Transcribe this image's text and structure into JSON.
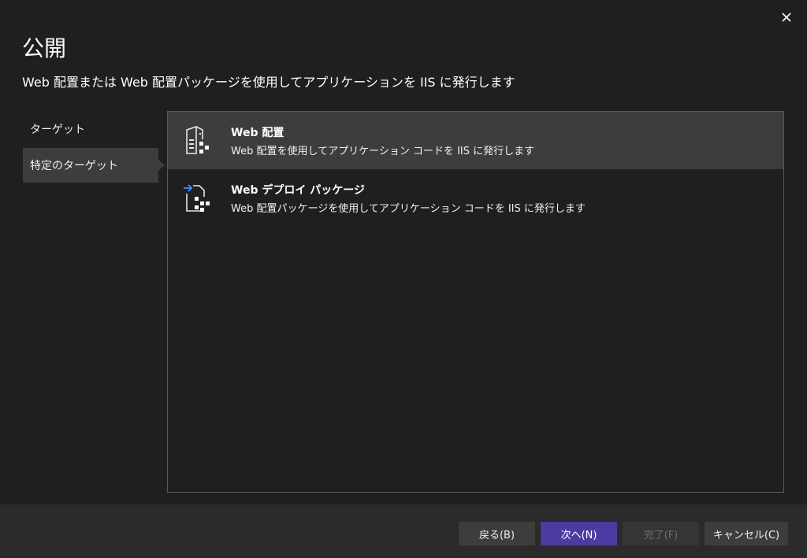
{
  "dialog": {
    "title": "公開",
    "subtitle": "Web 配置または Web 配置パッケージを使用してアプリケーションを IIS に発行します"
  },
  "nav": {
    "items": [
      {
        "label": "ターゲット",
        "selected": false
      },
      {
        "label": "特定のターゲット",
        "selected": true
      }
    ]
  },
  "options": [
    {
      "title": "Web 配置",
      "description": "Web 配置を使用してアプリケーション コードを IIS に発行します",
      "icon": "web-deploy-icon",
      "selected": true
    },
    {
      "title": "Web デプロイ パッケージ",
      "description": "Web 配置パッケージを使用してアプリケーション コードを IIS に発行します",
      "icon": "web-deploy-package-icon",
      "selected": false
    }
  ],
  "buttons": {
    "back": "戻る(B)",
    "next": "次へ(N)",
    "finish": "完了(F)",
    "cancel": "キャンセル(C)"
  },
  "colors": {
    "background": "#1f1f1f",
    "selected": "#3d3d3d",
    "primary_button": "#4c3ba0",
    "footer": "#2b2b2b"
  }
}
